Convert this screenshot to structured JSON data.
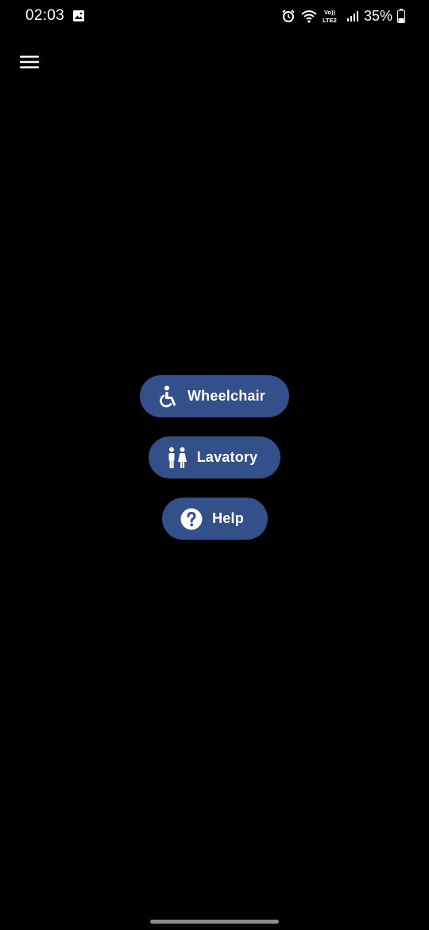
{
  "status_bar": {
    "time": "02:03",
    "battery_percent": "35%",
    "battery_level": 0.35,
    "network_label_top": "Vo))",
    "network_label_bottom": "LTE2",
    "icons": [
      "gallery-notification-icon",
      "alarm-icon",
      "wifi-icon",
      "volte-icon",
      "signal-icon",
      "battery-icon"
    ]
  },
  "app_bar": {
    "menu_icon": "hamburger-menu-icon"
  },
  "actions": [
    {
      "label": "Wheelchair",
      "icon": "wheelchair-icon"
    },
    {
      "label": "Lavatory",
      "icon": "restroom-icon"
    },
    {
      "label": "Help",
      "icon": "help-circle-icon"
    }
  ],
  "colors": {
    "background": "#000000",
    "button_fill": "#34508a",
    "text": "#ffffff",
    "gesture_bar": "#8a8a8a"
  }
}
